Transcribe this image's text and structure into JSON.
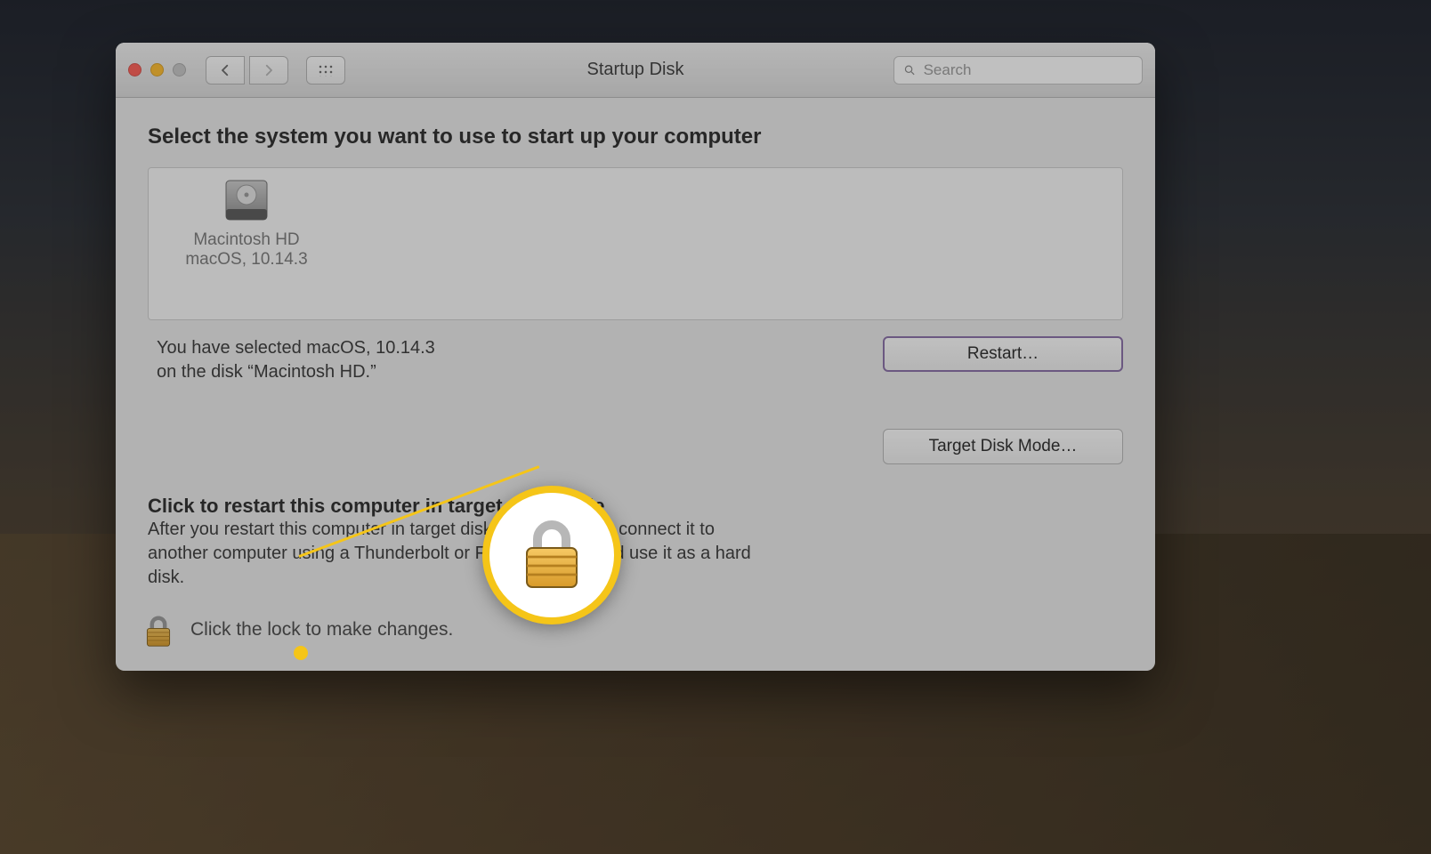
{
  "window": {
    "title": "Startup Disk"
  },
  "search": {
    "placeholder": "Search",
    "value": ""
  },
  "heading": "Select the system you want to use to start up your computer",
  "disk": {
    "name": "Macintosh HD",
    "version": "macOS, 10.14.3"
  },
  "selection_info": {
    "line1": "You have selected macOS, 10.14.3",
    "line2": "on the disk “Macintosh HD.”"
  },
  "buttons": {
    "restart": "Restart…",
    "target_disk_mode": "Target Disk Mode…"
  },
  "tdm": {
    "heading": "Click to restart this computer in target disk mode",
    "body": "After you restart this computer in target disk mode, you can connect it to another computer using a Thunderbolt or FireWire cable and use it as a hard disk."
  },
  "lock_hint": "Click the lock to make changes."
}
